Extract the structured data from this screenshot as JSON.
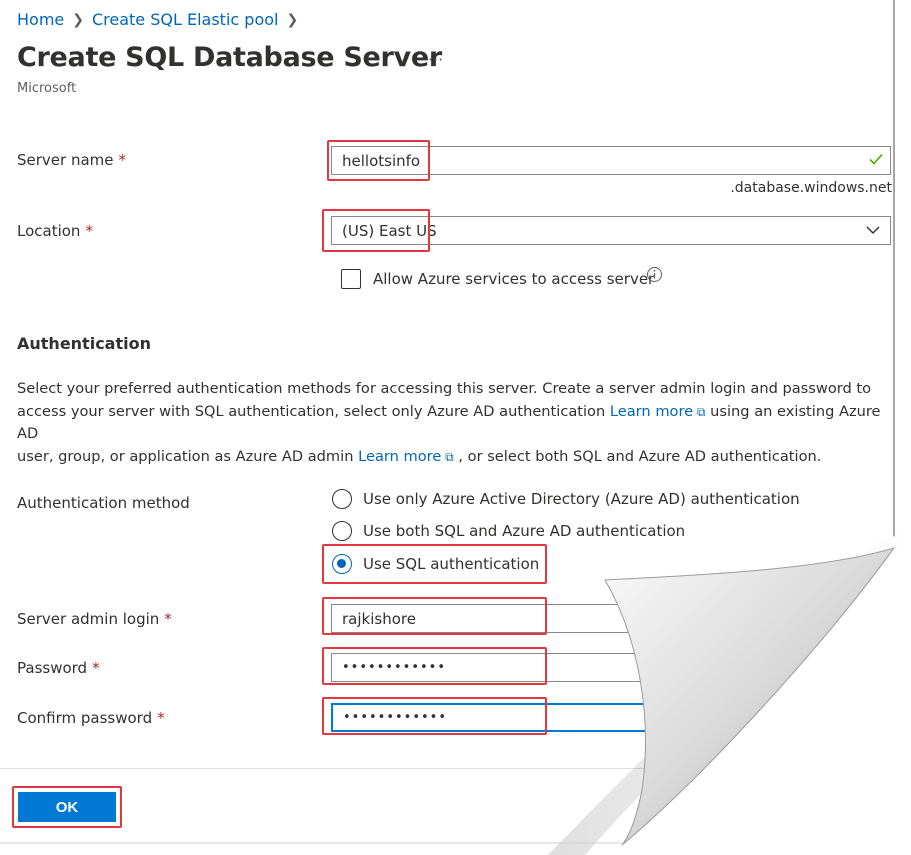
{
  "breadcrumb": {
    "items": [
      "Home",
      "Create SQL Elastic pool"
    ],
    "separator": ">"
  },
  "header": {
    "title": "Create SQL Database Server",
    "more_label": "···",
    "subtitle": "Microsoft"
  },
  "form": {
    "server_name": {
      "label": "Server name",
      "required": "*",
      "value": "hellotsinfo",
      "suffix": ".database.windows.net"
    },
    "location": {
      "label": "Location",
      "required": "*",
      "value": "(US) East US"
    },
    "allow_azure": {
      "label": "Allow Azure services to access server",
      "checked": false
    },
    "authentication": {
      "section_title": "Authentication",
      "description_1": "Select your preferred authentication methods for accessing this server. Create a server admin login and password to",
      "description_2a": "access your server with SQL authentication, select only Azure AD authentication ",
      "learn_more_1": "Learn more",
      "description_2b": " using an existing Azure AD",
      "description_3a": "user, group, or application as Azure AD admin ",
      "learn_more_2": "Learn more",
      "description_3b": " , or select both SQL and Azure AD authentication.",
      "method_label": "Authentication method",
      "options": [
        {
          "label": "Use only Azure Active Directory (Azure AD) authentication",
          "selected": false
        },
        {
          "label": "Use both SQL and Azure AD authentication",
          "selected": false
        },
        {
          "label": "Use SQL authentication",
          "selected": true
        }
      ]
    },
    "admin_login": {
      "label": "Server admin login",
      "required": "*",
      "value": "rajkishore"
    },
    "password": {
      "label": "Password",
      "required": "*",
      "value": "••••••••••••"
    },
    "confirm_password": {
      "label": "Confirm password",
      "required": "*",
      "value": "••••••••••••"
    }
  },
  "footer": {
    "ok_label": "OK"
  },
  "colors": {
    "accent": "#0078d4",
    "link": "#0067b8",
    "highlight": "#e0383e",
    "required": "#a4262c",
    "valid": "#57a300"
  }
}
